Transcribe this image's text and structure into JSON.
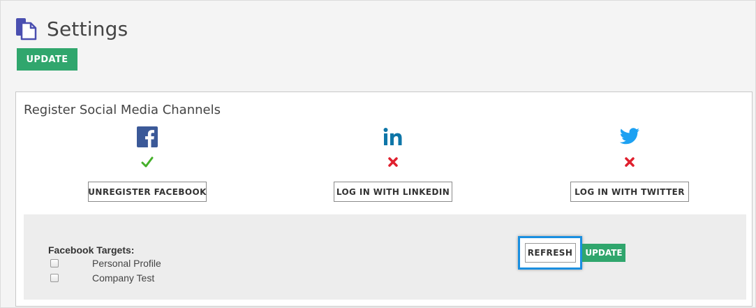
{
  "page": {
    "title": "Settings",
    "update_label": "UPDATE"
  },
  "panel": {
    "title": "Register Social Media Channels",
    "channels": [
      {
        "name": "facebook-icon",
        "status": "check-icon",
        "button_label": "UNREGISTER FACEBOOK",
        "color": "#3b5998",
        "status_color": "#45b02a"
      },
      {
        "name": "linkedin-icon",
        "status": "cross-icon",
        "button_label": "LOG IN WITH LINKEDIN",
        "color": "#0e76a8",
        "status_color": "#e0202e"
      },
      {
        "name": "twitter-icon",
        "status": "cross-icon",
        "button_label": "LOG IN WITH TWITTER",
        "color": "#1da1f2",
        "status_color": "#e0202e"
      }
    ]
  },
  "targets": {
    "label": "Facebook Targets:",
    "items": [
      {
        "label": "Personal Profile",
        "checked": false
      },
      {
        "label": "Company Test",
        "checked": false
      }
    ],
    "refresh_label": "REFRESH",
    "update_label": "UPDATE"
  },
  "colors": {
    "accent_green": "#30a66d",
    "highlight_blue": "#1a8fe0",
    "icon_purple": "#4a4fb0"
  }
}
